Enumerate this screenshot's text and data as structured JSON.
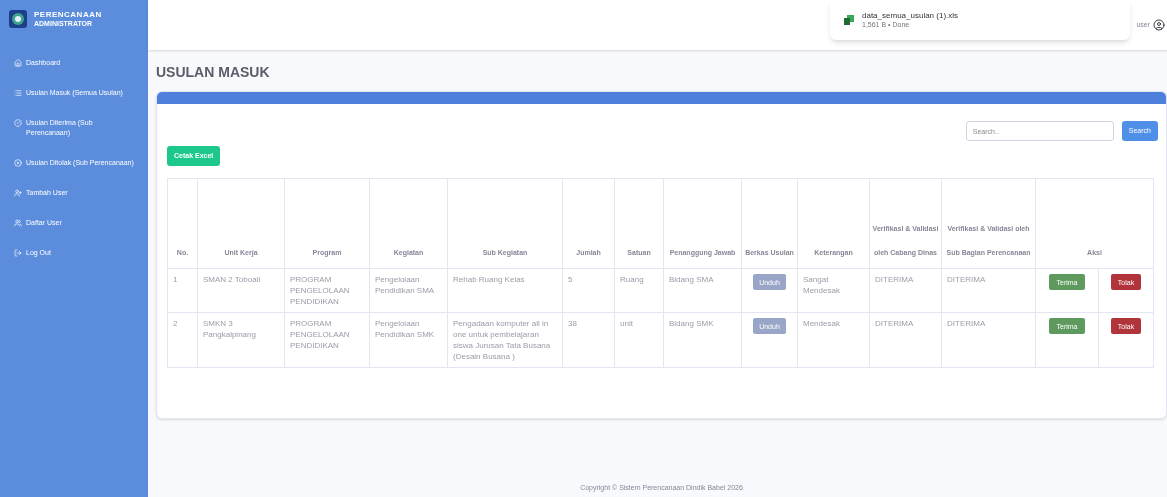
{
  "sidebar": {
    "brand": {
      "title": "PERENCANAAN",
      "subtitle": "ADMINISTRATOR"
    },
    "items": [
      {
        "label": "Dashboard"
      },
      {
        "label": "Usulan Masuk (Semua Usulan)"
      },
      {
        "label": "Usulan Diterima (Sub Perencanaan)"
      },
      {
        "label": "Usulan Ditolak (Sub Perencanaan)"
      },
      {
        "label": "Tambah User"
      },
      {
        "label": "Daftar User"
      },
      {
        "label": "Log Out"
      }
    ]
  },
  "topbar": {
    "user": "user"
  },
  "download": {
    "file": "data_semua_usulan (1).xls",
    "status": "1,561 B • Done"
  },
  "page_title": "USULAN MASUK",
  "search": {
    "placeholder": "Search..",
    "button": "Search"
  },
  "export_button": "Cetak Excel",
  "table": {
    "columns": [
      "No.",
      "Unit Kerja",
      "Program",
      "Kegiatan",
      "Sub Kegiatan",
      "Jumlah",
      "Satuan",
      "Penanggung Jawab",
      "Berkas Usulan",
      "Keterangan",
      "Verifikasi & Validasi oleh Cabang Dinas",
      "Verifikasi & Validasi oleh Sub Bagian Perencanaan",
      "Aksi"
    ],
    "rows": [
      {
        "no": "1",
        "unit": "SMAN 2 Toboali",
        "program": "PROGRAM PENGELOLAAN PENDIDIKAN",
        "kegiatan": "Pengelolaan Pendidikan SMA",
        "sub": "Rehab Ruang Kelas",
        "jumlah": "5",
        "satuan": "Ruang",
        "pj": "Bidang SMA",
        "berkas": "Unduh",
        "ket": "Sangat Mendesak",
        "v1": "DITERIMA",
        "v2": "DITERIMA",
        "accept": "Terima",
        "reject": "Tolak"
      },
      {
        "no": "2",
        "unit": "SMKN 3 Pangkalpinang",
        "program": "PROGRAM PENGELOLAAN PENDIDIKAN",
        "kegiatan": "Pengelolaan Pendidikan SMK",
        "sub": "Pengadaan komputer all in one untuk pembelajaran siswa Jurusan Tata Busana (Desain Busana )",
        "jumlah": "38",
        "satuan": "unit",
        "pj": "Bidang SMK",
        "berkas": "Unduh",
        "ket": "Mendesak",
        "v1": "DITERIMA",
        "v2": "DITERIMA",
        "accept": "Terima",
        "reject": "Tolak"
      }
    ]
  },
  "footer": "Copyright © Sistem Perencanaan Dindik Babel 2026"
}
